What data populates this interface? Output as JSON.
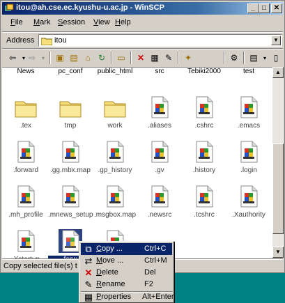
{
  "window": {
    "title": "itou@ah.cse.ec.kyushu-u.ac.jp - WinSCP",
    "min_glyph": "_",
    "max_glyph": "□",
    "close_glyph": "✕"
  },
  "menu": [
    {
      "accel": "F",
      "rest": "ile"
    },
    {
      "accel": "M",
      "rest": "ark"
    },
    {
      "accel": "S",
      "rest": "ession"
    },
    {
      "accel": "V",
      "rest": "iew"
    },
    {
      "accel": "H",
      "rest": "elp"
    }
  ],
  "address": {
    "label": "Address",
    "value": "itou"
  },
  "columns": [
    "News",
    "pc_conf",
    "public_html",
    "src",
    "Tebiki2000",
    "test"
  ],
  "files": [
    {
      "name": ".tex",
      "type": "folder"
    },
    {
      "name": "tmp",
      "type": "folder"
    },
    {
      "name": "work",
      "type": "folder"
    },
    {
      "name": ".aliases",
      "type": "file"
    },
    {
      "name": ".cshrc",
      "type": "file"
    },
    {
      "name": ".emacs",
      "type": "file"
    },
    {
      "name": ".forward",
      "type": "file"
    },
    {
      "name": ".gg.mbx.map",
      "type": "file"
    },
    {
      "name": ".gp_history",
      "type": "file"
    },
    {
      "name": ".gv",
      "type": "file"
    },
    {
      "name": ".history",
      "type": "file"
    },
    {
      "name": ".login",
      "type": "file"
    },
    {
      "name": ".mh_profile",
      "type": "file"
    },
    {
      "name": ".mnews_setup",
      "type": "file"
    },
    {
      "name": ".msgbox.map",
      "type": "file"
    },
    {
      "name": ".newsrc",
      "type": "file"
    },
    {
      "name": ".tcshrc",
      "type": "file"
    },
    {
      "name": ".Xauthority",
      "type": "file"
    },
    {
      "name": ".Xstartup",
      "type": "file"
    },
    {
      "name": "forw",
      "type": "file",
      "selected": true
    },
    {
      "name": "",
      "type": "file"
    }
  ],
  "status": {
    "text": "Copy selected file(s) t"
  },
  "context_menu": [
    {
      "icon": "copy-icon",
      "glyph": "⧉",
      "accel": "C",
      "rest": "opy ...",
      "shortcut": "Ctrl+C",
      "highlight": true
    },
    {
      "icon": "move-icon",
      "glyph": "⇄",
      "accel": "M",
      "rest": "ove ...",
      "shortcut": "Ctrl+M"
    },
    {
      "icon": "delete-icon",
      "glyph": "✕",
      "accel": "D",
      "rest": "elete",
      "shortcut": "Del",
      "color": "#d00000"
    },
    {
      "icon": "rename-icon",
      "glyph": "✎",
      "accel": "R",
      "rest": "ename",
      "shortcut": "F2"
    },
    {
      "icon": "properties-icon",
      "glyph": "▦",
      "accel": "P",
      "rest": "roperties",
      "shortcut": "Alt+Enter"
    }
  ],
  "colors": {
    "title_start": "#0a246a",
    "desktop": "#008080",
    "selection": "#0a246a",
    "folder_yellow": "#f6e07c"
  }
}
